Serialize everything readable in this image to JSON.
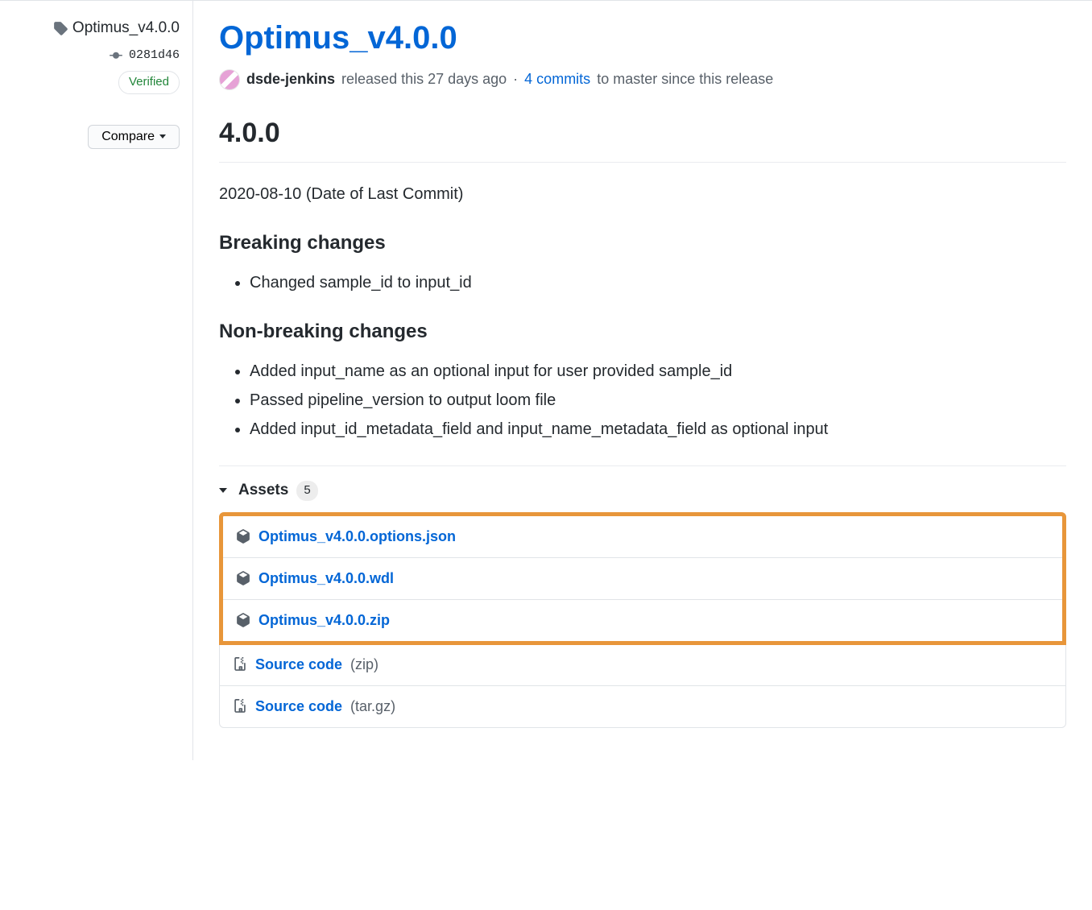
{
  "sidebar": {
    "tag_name": "Optimus_v4.0.0",
    "commit_sha": "0281d46",
    "verified_label": "Verified",
    "compare_label": "Compare"
  },
  "release": {
    "title": "Optimus_v4.0.0",
    "author": "dsde-jenkins",
    "released_text": "released this 27 days ago",
    "separator": "·",
    "commits_link": "4 commits",
    "commits_suffix": "to master since this release",
    "version_heading": "4.0.0",
    "date_line": "2020-08-10 (Date of Last Commit)",
    "breaking_heading": "Breaking changes",
    "breaking_items": [
      "Changed sample_id to input_id"
    ],
    "nonbreaking_heading": "Non-breaking changes",
    "nonbreaking_items": [
      "Added input_name as an optional input for user provided sample_id",
      "Passed pipeline_version to output loom file",
      "Added input_id_metadata_field and input_name_metadata_field as optional input"
    ]
  },
  "assets": {
    "label": "Assets",
    "count": "5",
    "highlighted": [
      {
        "name": "Optimus_v4.0.0.options.json",
        "icon": "package-icon"
      },
      {
        "name": "Optimus_v4.0.0.wdl",
        "icon": "package-icon"
      },
      {
        "name": "Optimus_v4.0.0.zip",
        "icon": "package-icon"
      }
    ],
    "other": [
      {
        "name": "Source code",
        "ext": "(zip)",
        "icon": "file-zip-icon"
      },
      {
        "name": "Source code",
        "ext": "(tar.gz)",
        "icon": "file-zip-icon"
      }
    ]
  }
}
